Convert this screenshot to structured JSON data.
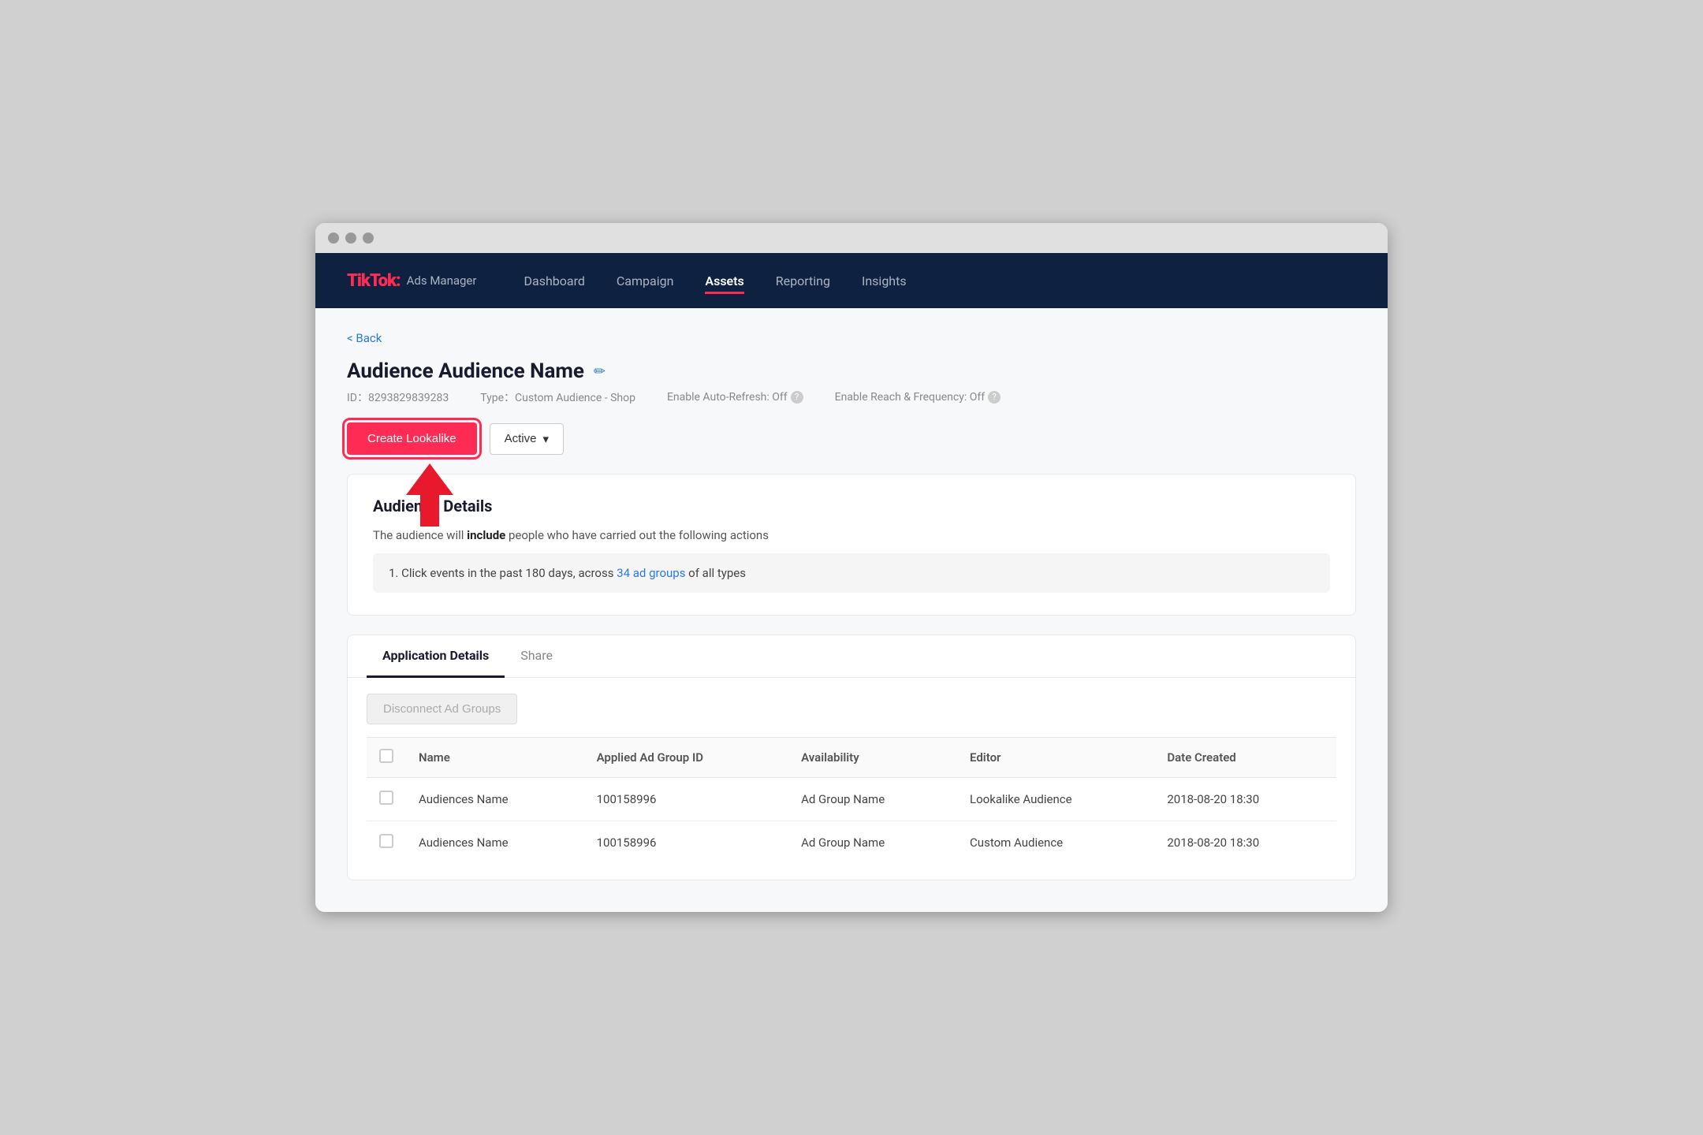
{
  "browser": {
    "traffic_lights": [
      "close",
      "minimize",
      "maximize"
    ]
  },
  "nav": {
    "brand_name": "TikTok",
    "brand_colon": ":",
    "brand_sub": "Ads Manager",
    "links": [
      {
        "label": "Dashboard",
        "active": false
      },
      {
        "label": "Campaign",
        "active": false
      },
      {
        "label": "Assets",
        "active": true
      },
      {
        "label": "Reporting",
        "active": false
      },
      {
        "label": "Insights",
        "active": false
      }
    ]
  },
  "back_label": "Back",
  "page": {
    "title": "Audience Audience Name",
    "edit_icon": "✏",
    "id_label": "ID：8293829839283",
    "type_label": "Type：Custom Audience - Shop",
    "auto_refresh_label": "Enable Auto-Refresh: Off",
    "reach_freq_label": "Enable Reach & Frequency: Off",
    "help_icon": "?"
  },
  "actions": {
    "create_lookalike_label": "Create Lookalike",
    "active_label": "Active",
    "chevron": "▾"
  },
  "audience_section": {
    "title": "Audience Details",
    "desc_prefix": "The audience will ",
    "desc_bold": "include",
    "desc_suffix": " people who have carried out the following actions",
    "rule": "1. Click events in the past 180 days, across ",
    "rule_link": "34 ad groups",
    "rule_suffix": " of all types"
  },
  "tabs": [
    {
      "label": "Application Details",
      "active": true
    },
    {
      "label": "Share",
      "active": false
    }
  ],
  "disconnect_label": "Disconnect Ad Groups",
  "table": {
    "columns": [
      {
        "label": ""
      },
      {
        "label": "Name"
      },
      {
        "label": "Applied Ad Group ID"
      },
      {
        "label": "Availability"
      },
      {
        "label": "Editor"
      },
      {
        "label": "Date Created"
      }
    ],
    "rows": [
      {
        "name": "Audiences Name",
        "ad_group_id": "100158996",
        "availability": "Ad Group Name",
        "editor": "Lookalike Audience",
        "date_created": "2018-08-20 18:30"
      },
      {
        "name": "Audiences Name",
        "ad_group_id": "100158996",
        "availability": "Ad Group Name",
        "editor": "Custom Audience",
        "date_created": "2018-08-20 18:30"
      }
    ]
  }
}
